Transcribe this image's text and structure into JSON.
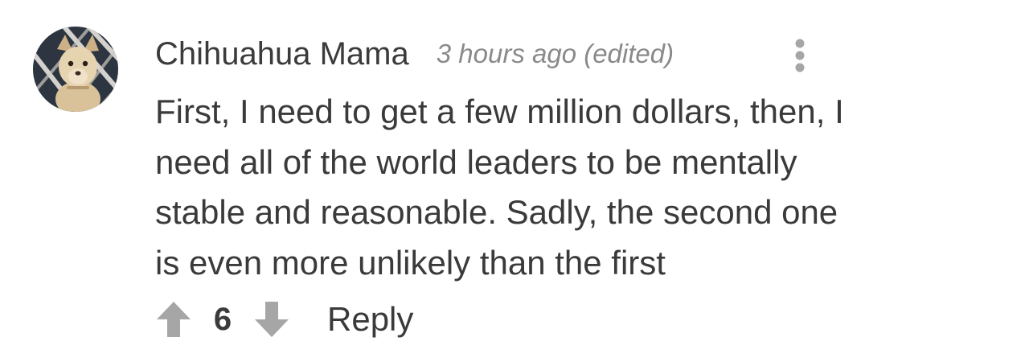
{
  "comment": {
    "author": "Chihuahua Mama",
    "timestamp": "3 hours ago (edited)",
    "avatar_icon": "chihuahua-avatar",
    "more_icon": "vertical-ellipsis-icon",
    "body_lines": [
      "First, I need to get a few million dollars, then, I",
      "need all of the world leaders to be mentally",
      "stable and reasonable. Sadly, the second one",
      "is even more unlikely than the first"
    ],
    "votes": {
      "upvote_icon": "arrow-up-icon",
      "count": "6",
      "downvote_icon": "arrow-down-icon"
    },
    "reply_label": "Reply"
  },
  "colors": {
    "text": "#3a3a3a",
    "muted": "#8a8a8a",
    "icon": "#a6a6a6",
    "background": "#ffffff"
  }
}
